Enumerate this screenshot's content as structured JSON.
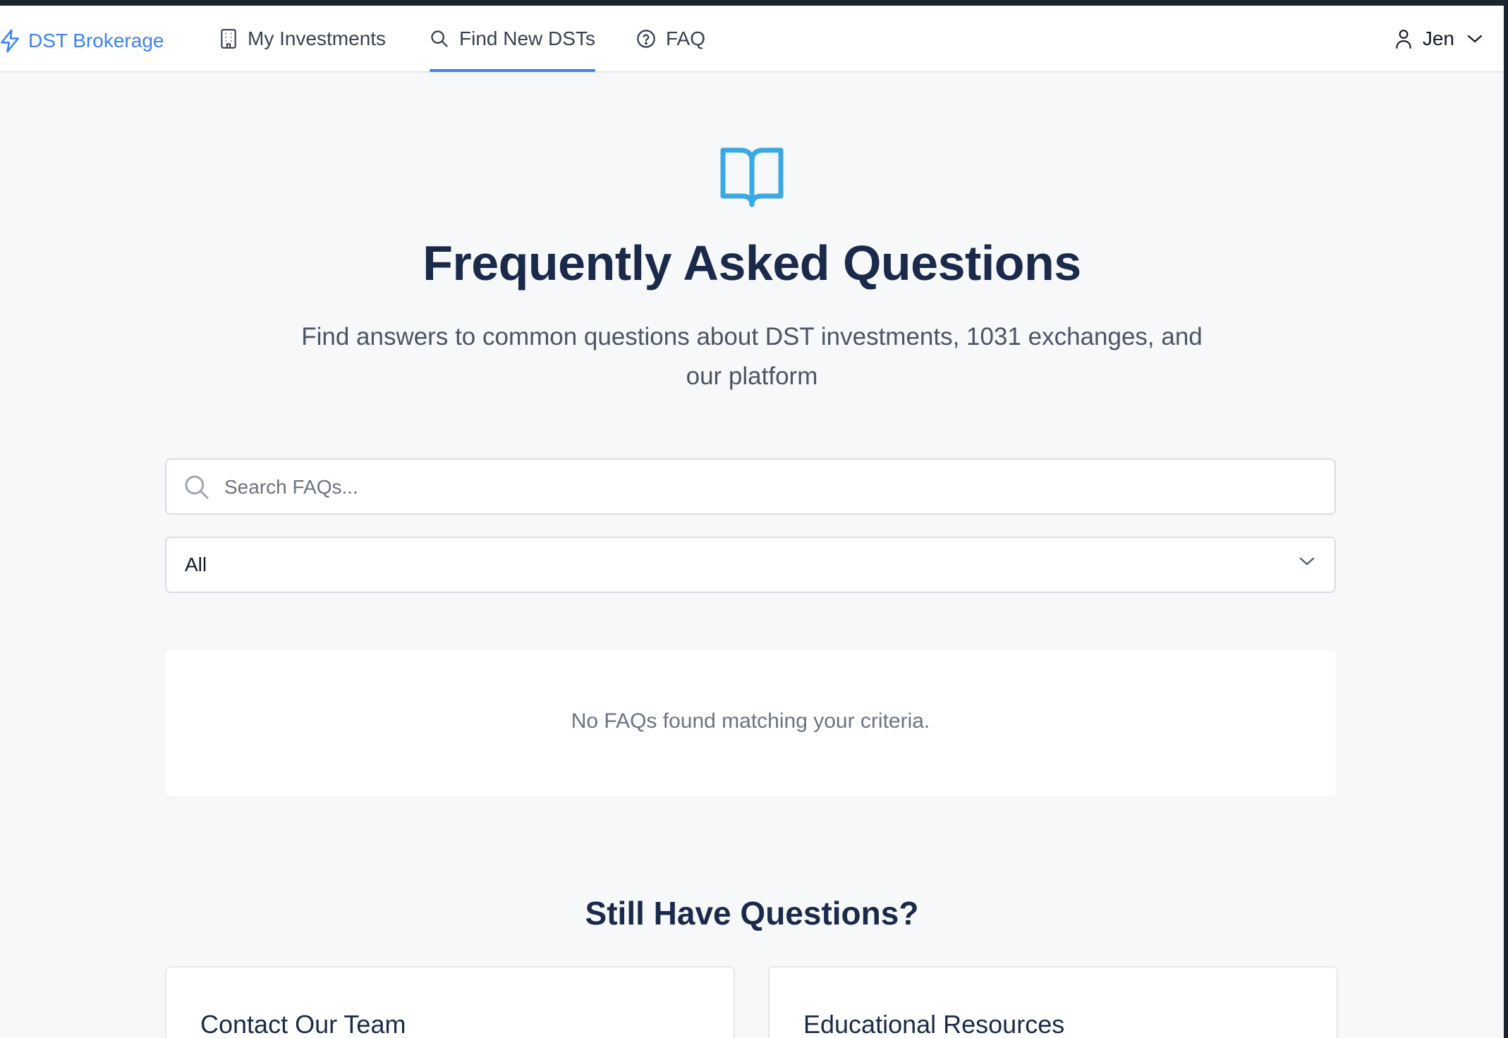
{
  "nav": {
    "brand": "DST Brokerage",
    "items": [
      {
        "label": "My Investments",
        "icon": "building-icon"
      },
      {
        "label": "Find New DSTs",
        "icon": "search-icon",
        "active": true
      },
      {
        "label": "FAQ",
        "icon": "help-circle-icon"
      }
    ],
    "user": {
      "name": "Jen"
    }
  },
  "hero": {
    "icon": "book-open-icon",
    "title": "Frequently Asked Questions",
    "subtitle": "Find answers to common questions about DST investments, 1031 exchanges, and our platform"
  },
  "search": {
    "placeholder": "Search FAQs...",
    "value": ""
  },
  "filter": {
    "selected": "All"
  },
  "results": {
    "empty_message": "No FAQs found matching your criteria."
  },
  "help": {
    "title": "Still Have Questions?",
    "cards": [
      {
        "title": "Contact Our Team"
      },
      {
        "title": "Educational Resources"
      }
    ]
  },
  "colors": {
    "accent": "#3b82f6",
    "heading": "#1b2a4a",
    "hero_icon": "#3aa9e3",
    "page_bg": "#f7f8fa"
  }
}
